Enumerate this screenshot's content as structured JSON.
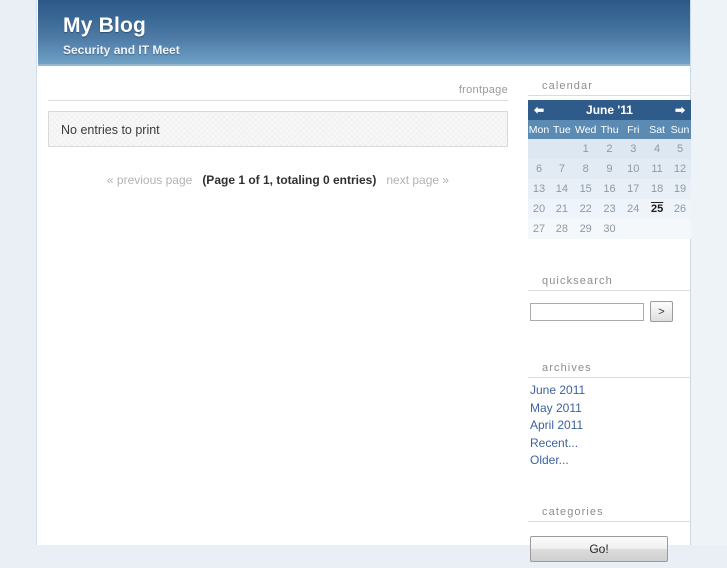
{
  "header": {
    "title": "My Blog",
    "subtitle": "Security and IT Meet"
  },
  "main": {
    "section_label": "frontpage",
    "entry_message": "No entries to print",
    "pagination": {
      "previous": "« previous page",
      "info": "(Page 1 of 1, totaling 0 entries)",
      "next": "next page »"
    }
  },
  "sidebar": {
    "calendar": {
      "title": "calendar",
      "prev_icon": "⬅",
      "next_icon": "➡",
      "month_label": "June '11",
      "daynames": [
        "Mon",
        "Tue",
        "Wed",
        "Thu",
        "Fri",
        "Sat",
        "Sun"
      ],
      "weeks": [
        [
          "",
          "",
          "1",
          "2",
          "3",
          "4",
          "5"
        ],
        [
          "6",
          "7",
          "8",
          "9",
          "10",
          "11",
          "12"
        ],
        [
          "13",
          "14",
          "15",
          "16",
          "17",
          "18",
          "19"
        ],
        [
          "20",
          "21",
          "22",
          "23",
          "24",
          "25",
          "26"
        ],
        [
          "27",
          "28",
          "29",
          "30",
          "",
          "",
          ""
        ]
      ],
      "today": "25"
    },
    "quicksearch": {
      "title": "quicksearch",
      "input_value": "",
      "input_placeholder": "",
      "submit_label": ">"
    },
    "archives": {
      "title": "archives",
      "items": [
        {
          "label": "June 2011"
        },
        {
          "label": "May 2011"
        },
        {
          "label": "April 2011"
        },
        {
          "label": "Recent..."
        },
        {
          "label": "Older..."
        }
      ]
    },
    "categories": {
      "title": "categories",
      "go_label": "Go!"
    }
  },
  "colors": {
    "header_top": "#2c5887",
    "header_bottom": "#7aa6c8",
    "calendar_header": "#2e5b8a",
    "calendar_daynames": "#5b8ab3",
    "link": "#3c63a0",
    "page_background": "#e9eff4"
  }
}
